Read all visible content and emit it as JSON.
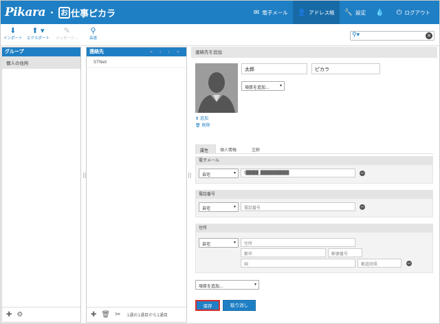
{
  "brand": {
    "name": "Pikara",
    "dot": "・",
    "o_char": "お",
    "sub": "仕事ピカラ"
  },
  "nav": [
    {
      "icon": "mail-icon",
      "glyph": "✉",
      "label": "電子メール"
    },
    {
      "icon": "address-book-icon",
      "glyph": "👤",
      "label": "アドレス帳"
    },
    {
      "icon": "wrench-icon",
      "glyph": "🔧",
      "label": "設定"
    },
    {
      "icon": "drop-icon",
      "glyph": "💧",
      "label": ""
    },
    {
      "icon": "power-icon",
      "glyph": "⏻",
      "label": "ログアウト"
    }
  ],
  "toolbar": {
    "import": "インポート",
    "export": "エクスポート",
    "message": "メッセージ...",
    "search": "高速"
  },
  "search": {
    "placeholder": "",
    "value": ""
  },
  "groups": {
    "title": "グループ",
    "items": [
      "個人の住所"
    ]
  },
  "contacts": {
    "title": "連絡先",
    "pager": "« ‹ › »",
    "items": [
      "STNet"
    ],
    "count": "1通の1通目から1通目"
  },
  "detail": {
    "title": "連絡先を追加",
    "first_name": "太郎",
    "last_name": "ピカラ",
    "add_field": "項目を追加...",
    "upload": "追加",
    "delete": "削除",
    "tabs": [
      "属性",
      "個人情報",
      "注釈"
    ],
    "email": {
      "title": "電子メール",
      "type": "自宅",
      "value": "t████_█████████"
    },
    "phone": {
      "title": "電話番号",
      "type": "自宅",
      "placeholder": "電話番号"
    },
    "address": {
      "title": "住所",
      "type": "自宅",
      "street": "住所",
      "city": "都市",
      "zip": "郵便番号",
      "country": "国",
      "state": "都道府県"
    },
    "add_field_bottom": "項目を追加...",
    "save": "保存",
    "cancel": "取り消し"
  },
  "colors": {
    "primary": "#1f7fc4",
    "highlight": "#d9302c"
  }
}
